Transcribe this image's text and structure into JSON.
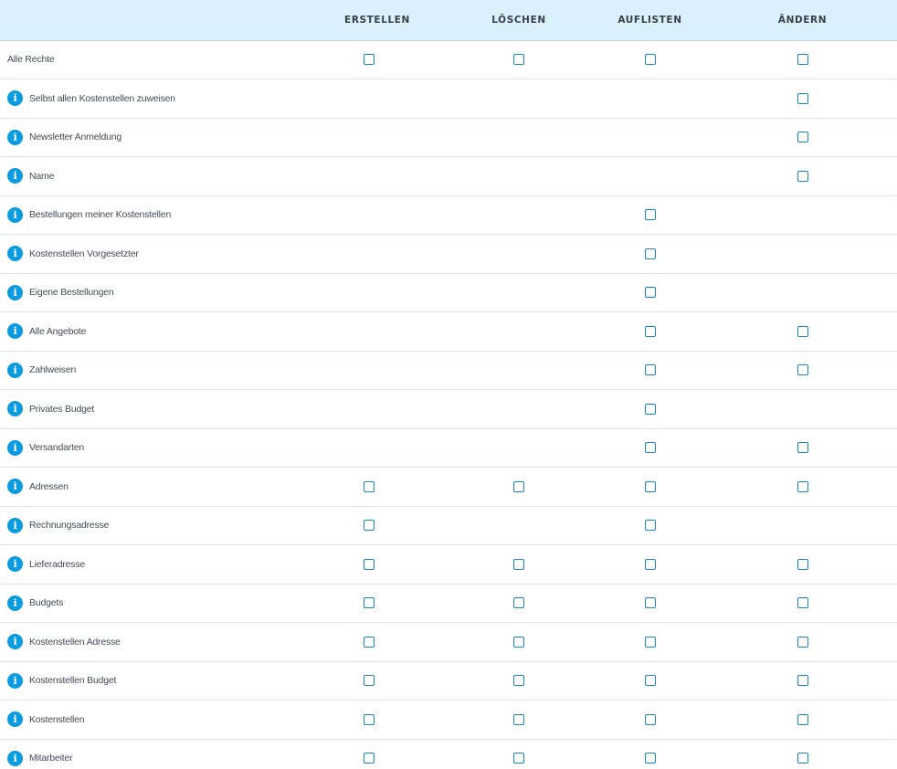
{
  "header": {
    "columns": [
      "ERSTELLEN",
      "LÖSCHEN",
      "AUFLISTEN",
      "ÄNDERN"
    ]
  },
  "rows": [
    {
      "label": "Alle Rechte",
      "info": false,
      "checks": [
        true,
        true,
        true,
        true
      ]
    },
    {
      "label": "Selbst allen Kostenstellen zuweisen",
      "info": true,
      "checks": [
        false,
        false,
        false,
        true
      ]
    },
    {
      "label": "Newsletter Anmeldung",
      "info": true,
      "checks": [
        false,
        false,
        false,
        true
      ]
    },
    {
      "label": "Name",
      "info": true,
      "checks": [
        false,
        false,
        false,
        true
      ]
    },
    {
      "label": "Bestellungen meiner Kostenstellen",
      "info": true,
      "checks": [
        false,
        false,
        true,
        false
      ]
    },
    {
      "label": "Kostenstellen Vorgesetzter",
      "info": true,
      "checks": [
        false,
        false,
        true,
        false
      ]
    },
    {
      "label": "Eigene Bestellungen",
      "info": true,
      "checks": [
        false,
        false,
        true,
        false
      ]
    },
    {
      "label": "Alle Angebote",
      "info": true,
      "checks": [
        false,
        false,
        true,
        true
      ]
    },
    {
      "label": "Zahlweisen",
      "info": true,
      "checks": [
        false,
        false,
        true,
        true
      ]
    },
    {
      "label": "Privates Budget",
      "info": true,
      "checks": [
        false,
        false,
        true,
        false
      ]
    },
    {
      "label": "Versandarten",
      "info": true,
      "checks": [
        false,
        false,
        true,
        true
      ]
    },
    {
      "label": "Adressen",
      "info": true,
      "checks": [
        true,
        true,
        true,
        true
      ]
    },
    {
      "label": "Rechnungsadresse",
      "info": true,
      "checks": [
        true,
        false,
        true,
        false
      ]
    },
    {
      "label": "Lieferadresse",
      "info": true,
      "checks": [
        true,
        true,
        true,
        true
      ]
    },
    {
      "label": "Budgets",
      "info": true,
      "checks": [
        true,
        true,
        true,
        true
      ]
    },
    {
      "label": "Kostenstellen Adresse",
      "info": true,
      "checks": [
        true,
        true,
        true,
        true
      ]
    },
    {
      "label": "Kostenstellen Budget",
      "info": true,
      "checks": [
        true,
        true,
        true,
        true
      ]
    },
    {
      "label": "Kostenstellen",
      "info": true,
      "checks": [
        true,
        true,
        true,
        true
      ]
    },
    {
      "label": "Mitarbeiter",
      "info": true,
      "checks": [
        true,
        true,
        true,
        true
      ]
    }
  ],
  "icons": {
    "info": "info-icon",
    "info_glyph": "i"
  },
  "colors": {
    "header_bg": "#daf0fa",
    "info_icon": "#0a9be0",
    "checkbox_border": "#1a84c8"
  }
}
